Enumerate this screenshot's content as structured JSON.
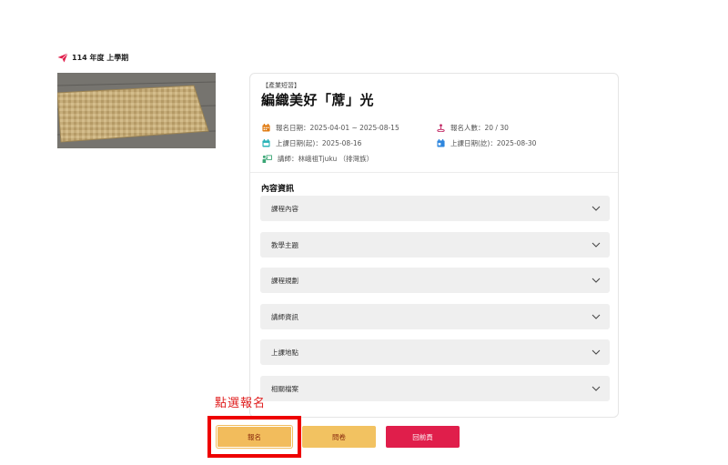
{
  "header": {
    "semester": "114 年度 上學期",
    "icon": "paper-plane-icon"
  },
  "course": {
    "category": "【產業短習】",
    "title": "編織美好「蓆」光",
    "info": {
      "registration_label": "報名日期",
      "registration_value": "2025-04-01 ~ 2025-08-15",
      "enrollment_label": "報名人數",
      "enrollment_value": "20 / 30",
      "start_label": "上課日期(起)",
      "start_value": "2025-08-16",
      "end_label": "上課日期(訖)",
      "end_value": "2025-08-30",
      "instructor_label": "講師",
      "instructor_value": "林峨祖Tjuku （排灣族）"
    }
  },
  "content": {
    "section_title": "內容資訊",
    "items": [
      {
        "label": "課程內容"
      },
      {
        "label": "教學主題"
      },
      {
        "label": "課程規劃"
      },
      {
        "label": "講師資訊"
      },
      {
        "label": "上課地點"
      },
      {
        "label": "相關檔案"
      }
    ]
  },
  "annotation": {
    "text": "點選報名"
  },
  "actions": {
    "register": "報名",
    "survey": "問卷",
    "back": "回前頁"
  },
  "colors": {
    "accent_red": "#e01e4b",
    "button_yellow": "#f2bc5c",
    "button_text": "#8a2b0e",
    "annotation_red": "#ee0000",
    "icon_orange": "#e07b12",
    "icon_teal": "#2bb3b8",
    "icon_blue": "#2e86de",
    "icon_magenta": "#c4306a",
    "icon_green": "#3aa675"
  }
}
